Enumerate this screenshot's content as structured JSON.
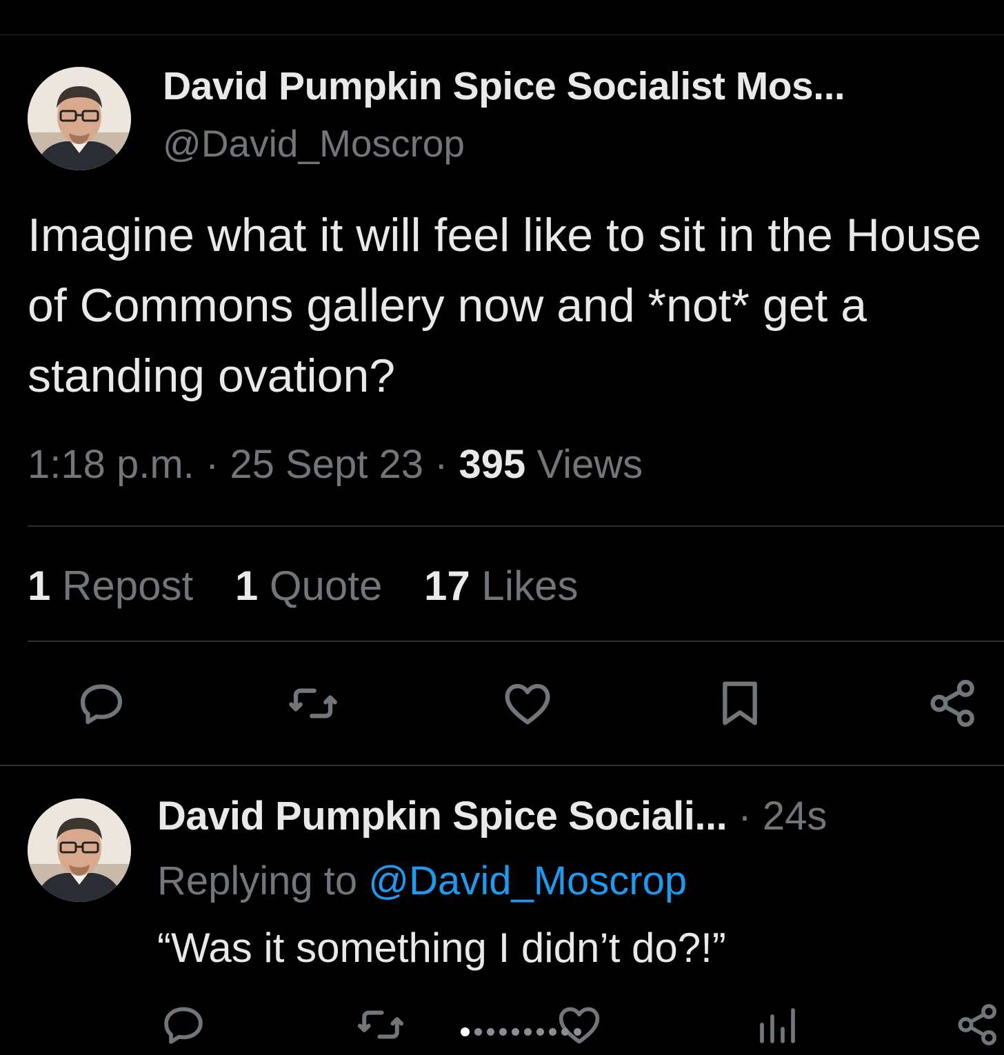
{
  "tweet": {
    "author_name": "David Pumpkin Spice Socialist Mos...",
    "author_handle": "@David_Moscrop",
    "text": "Imagine what it will feel like to sit in the House of Commons gallery now and *not* get a standing ovation?",
    "time": "1:18 p.m.",
    "date": "25 Sept 23",
    "views_count": "395",
    "views_label": "Views",
    "separator": "·",
    "stats": {
      "reposts_count": "1",
      "reposts_label": "Repost",
      "quotes_count": "1",
      "quotes_label": "Quote",
      "likes_count": "17",
      "likes_label": "Likes"
    },
    "actions": [
      "reply-icon",
      "repost-icon",
      "like-icon",
      "bookmark-icon",
      "share-icon"
    ]
  },
  "reply": {
    "author_name": "David Pumpkin Spice Sociali...",
    "time_ago": "24s",
    "separator": "·",
    "replying_prefix": "Replying to",
    "replying_mention": "@David_Moscrop",
    "text": "“Was it something I didn’t do?!”",
    "actions": [
      "reply-icon",
      "repost-icon",
      "like-icon",
      "views-icon",
      "share-icon"
    ]
  },
  "colors": {
    "background": "#000000",
    "text_primary": "#e7e9ea",
    "text_secondary": "#71767b",
    "link": "#1d9bf0",
    "divider": "#2f3336"
  }
}
